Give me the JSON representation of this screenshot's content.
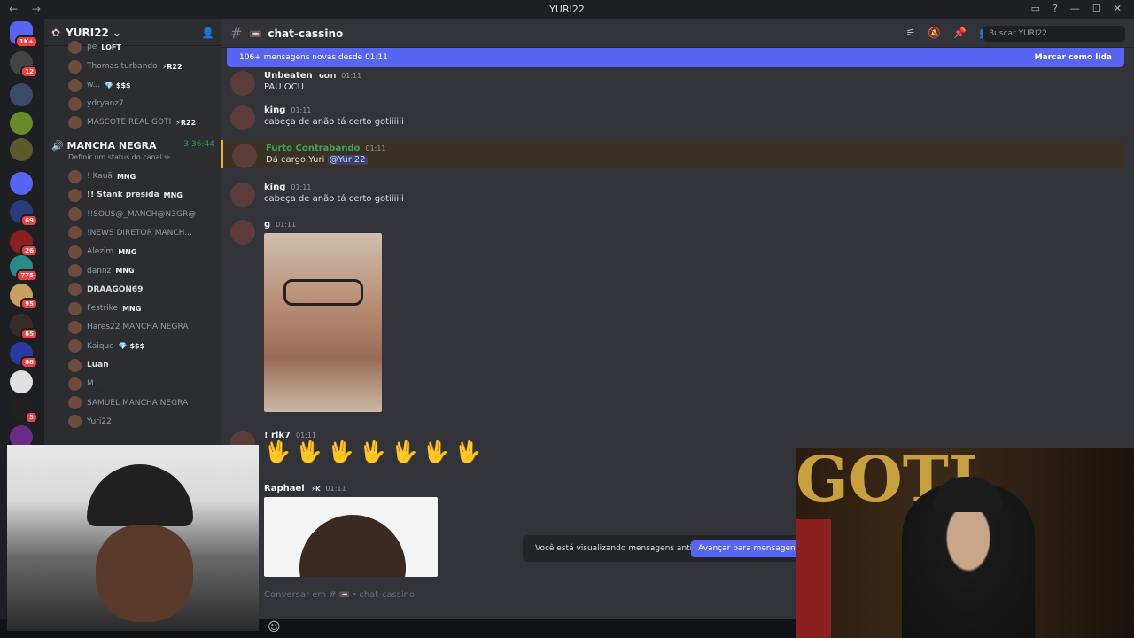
{
  "window": {
    "title": "YURI22",
    "nav": "← →"
  },
  "servers": [
    {
      "badge": "1K+",
      "color": "#5865f2"
    },
    {
      "badge": "12",
      "color": "#444"
    },
    {
      "badge": "",
      "color": "#3a4b6a"
    },
    {
      "badge": "",
      "color": "#6a8a2a"
    },
    {
      "badge": "",
      "color": "#5a5a2a"
    },
    {
      "badge": "",
      "color": "#5865f2"
    },
    {
      "badge": "69",
      "color": "#2a3a7a"
    },
    {
      "badge": "26",
      "color": "#8a2020"
    },
    {
      "badge": "775",
      "color": "#2a8a8a"
    },
    {
      "badge": "95",
      "color": "#c8a060"
    },
    {
      "badge": "65",
      "color": "#3a2a2a"
    },
    {
      "badge": "88",
      "color": "#2a3aa0"
    },
    {
      "badge": "",
      "color": "#e0e0e0"
    },
    {
      "badge": "3",
      "color": "#202020"
    },
    {
      "badge": "",
      "color": "#6a2a8a"
    }
  ],
  "channels": {
    "server_name": "YURI22",
    "members_top": [
      {
        "name": "pe",
        "tag": "LOFT"
      },
      {
        "name": "Thomas turbando",
        "tag": "⚡R22"
      },
      {
        "name": "w...",
        "tag": "💎 $$$"
      },
      {
        "name": "ydryanz7",
        "tag": ""
      },
      {
        "name": "MASCOTE REAL GOTI",
        "tag": "⚡R22"
      }
    ],
    "voice": {
      "name": "MANCHA NEGRA",
      "time": "3:36:44",
      "status": "Definir um status do canal ✏"
    },
    "members": [
      {
        "name": "! Kauã",
        "tag": "MNG"
      },
      {
        "name": "!! Stank presida",
        "tag": "MNG"
      },
      {
        "name": "!!SOUS@_MANCH@N3GR@",
        "tag": ""
      },
      {
        "name": "!NEWS DIRETOR MANCH...",
        "tag": ""
      },
      {
        "name": "Alezim",
        "tag": "MNG"
      },
      {
        "name": "dannz",
        "tag": "MNG"
      },
      {
        "name": "DRAAGON69",
        "tag": ""
      },
      {
        "name": "Festrike",
        "tag": "MNG"
      },
      {
        "name": "Hares22 MANCHA NEGRA",
        "tag": ""
      },
      {
        "name": "Kaique",
        "tag": "💎 $$$"
      },
      {
        "name": "Luan",
        "tag": ""
      },
      {
        "name": "M...",
        "tag": ""
      },
      {
        "name": "SAMUEL MANCHA NEGRA",
        "tag": ""
      },
      {
        "name": "Yuri22",
        "tag": ""
      }
    ]
  },
  "main": {
    "channel": "chat-cassino",
    "search_placeholder": "Buscar YURI22",
    "new_messages": "106+ mensagens novas desde 01:11",
    "mark_read": "Marcar como lida",
    "messages": [
      {
        "author": "Unbeaten",
        "badge": "GOTI",
        "time": "01:11",
        "text": "PAU OCU"
      },
      {
        "author": "king",
        "time": "01:11",
        "text": "cabeça de anão tá certo gotiiiiii"
      },
      {
        "author": "Furto Contrabando",
        "time": "01:11",
        "text": "Dá cargo Yuri",
        "mention": "@Yuri22"
      },
      {
        "author": "king",
        "time": "01:11",
        "text": "cabeça de anão tá certo gotiiiiii"
      },
      {
        "author": "g",
        "time": "01:11",
        "text": ""
      },
      {
        "author": "! rlk7",
        "time": "01:11",
        "text": "🖖🖖🖖🖖🖖🖖🖖"
      },
      {
        "author": "Raphael",
        "badge": "⚡K",
        "time": "01:11",
        "text": ""
      }
    ],
    "old_notice": "Você está visualizando mensagens antigas",
    "jump_button": "Avançar para mensagens re",
    "composer_placeholder": "Conversar em # 📼・chat-cassino"
  }
}
